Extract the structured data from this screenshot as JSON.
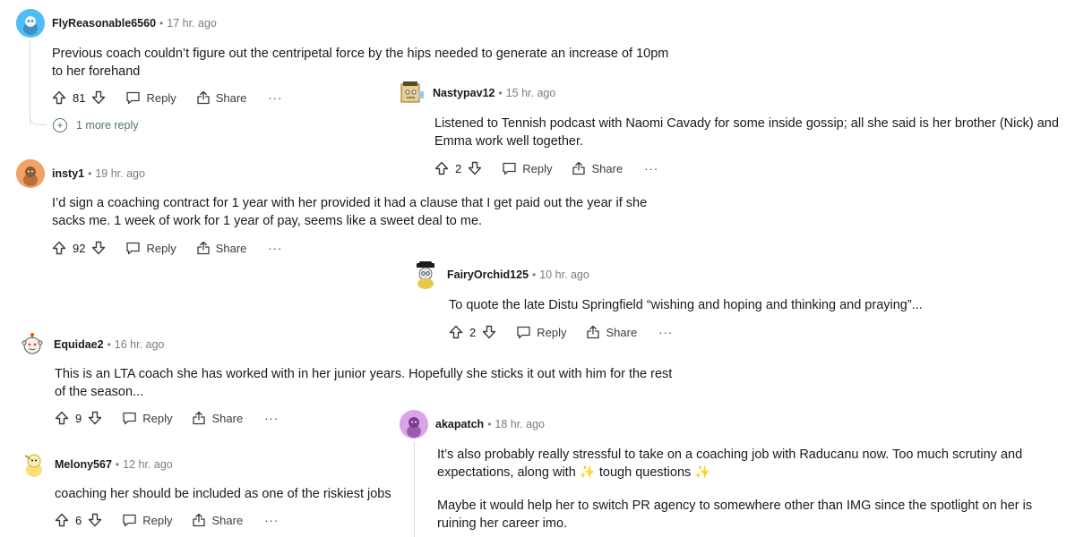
{
  "comments": [
    {
      "username": "FlyReasonable6560",
      "time": "17 hr. ago",
      "body": [
        "Previous coach couldn’t figure out the centripetal force by the hips needed to generate an increase of 10pm to her forehand"
      ],
      "score": "81",
      "avatar_color": "#4fbdf4"
    },
    {
      "username": "insty1",
      "time": "19 hr. ago",
      "body": [
        "I’d sign a coaching contract for 1 year with her provided it had a clause that I get paid out the year if she sacks me. 1 week of work for 1 year of pay, seems like a sweet deal to me."
      ],
      "score": "92",
      "avatar_color": "#f3a266"
    },
    {
      "username": "Equidae2",
      "time": "16 hr. ago",
      "body": [
        "This is an LTA coach she has worked with in her junior years. Hopefully she sticks it out with him for the rest of the season..."
      ],
      "score": "9",
      "avatar_color": "#ffffff"
    },
    {
      "username": "Melony567",
      "time": "12 hr. ago",
      "body": [
        "coaching her should be included as one of the riskiest jobs"
      ],
      "score": "6",
      "avatar_color": "#ffffff"
    },
    {
      "username": "Nastypav12",
      "time": "15 hr. ago",
      "body": [
        "Listened to Tennish podcast with Naomi Cavady for some inside gossip; all she said is her brother (Nick) and Emma work well together."
      ],
      "score": "2",
      "avatar_color": "#ffffff"
    },
    {
      "username": "FairyOrchid125",
      "time": "10 hr. ago",
      "body": [
        "To quote the late Distu Springfield “wishing and hoping and thinking and praying”..."
      ],
      "score": "2",
      "avatar_color": "#ffffff"
    },
    {
      "username": "akapatch",
      "time": "18 hr. ago",
      "body": [
        "It’s also probably really stressful to take on a coaching job with Raducanu now. Too much scrutiny and expectations, along with ✨ tough questions ✨",
        "Maybe it would help her to switch PR agency to somewhere other than IMG since the spotlight on her is ruining her career imo."
      ],
      "score": "",
      "avatar_color": "#d9a4e8"
    }
  ],
  "labels": {
    "separator": "•",
    "reply": "Reply",
    "share": "Share",
    "more": "···",
    "more_replies": "1 more reply",
    "more_replies_icon": "+"
  },
  "colors": {
    "text": "#1a1a1b",
    "meta": "#7c7c7c",
    "thread_line": "#d7dadc"
  }
}
